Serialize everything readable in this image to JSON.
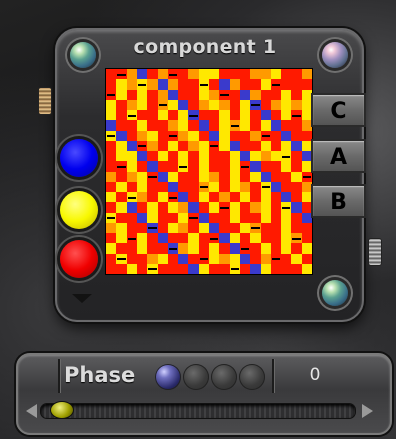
{
  "window": {
    "title": "component 1"
  },
  "side_buttons": [
    "C",
    "A",
    "B"
  ],
  "color_swatches": [
    {
      "name": "blue",
      "color": "#0000ee"
    },
    {
      "name": "yellow",
      "color": "#f8f800"
    },
    {
      "name": "red",
      "color": "#f00000"
    }
  ],
  "matrix": {
    "rows": 20,
    "cols": 20,
    "palette": {
      "R": "#ff1a00",
      "O": "#ff9a00",
      "Y": "#ffe800",
      "B": "#3a3acc"
    },
    "grid": [
      "RROBRORROYYRRROOYRRO",
      "RYOYOBORRYRBORRYRRRR",
      "RYRYROBRRYORRBORRYRY",
      "YROYROYBROYORYBROYOY",
      "YRYRRYRYBRRYRYRBRYRY",
      "BRRYRROYRBRYOYRYBRRO",
      "YBROYRROYRBYRRORRBRR",
      "RYBRORYROYRYBRRYRYBY",
      "RYYBRYRYRYRRYBYOYYRB",
      "RRYRBRRYRYRRYRBRRYRY",
      "OROYRBYRRYORYRYBRRYR",
      "RYRYRRBRROYRYORYBRRO",
      "YRYORYRBRYRORYRYRBRY",
      "RYBRYRYOBRYRYROYRYBR",
      "YRRBYRRYRBRRYRRYRYRB",
      "OYRRBRYORYBRRYORRYRR",
      "RYRYRBRRYRRBYRYRRYOR",
      "YRRYRRBOYRYRBRRYRYRY",
      "RYRROYRBRRYOYBRORRYR",
      "RRYRYRRRBYRRYRBYRRRY"
    ],
    "dashes": [
      "0,1",
      "0,6",
      "1,3",
      "1,9",
      "1,16",
      "2,0",
      "2,11",
      "3,5",
      "3,14",
      "4,2",
      "4,8",
      "4,18",
      "5,12",
      "6,0",
      "6,6",
      "6,15",
      "7,3",
      "7,10",
      "8,17",
      "9,1",
      "9,7",
      "9,13",
      "10,4",
      "10,19",
      "11,9",
      "11,15",
      "12,2",
      "12,6",
      "13,11",
      "13,17",
      "14,0",
      "14,8",
      "15,4",
      "15,14",
      "16,2",
      "16,10",
      "16,18",
      "17,6",
      "17,13",
      "18,1",
      "18,9",
      "18,16",
      "19,4",
      "19,12"
    ]
  },
  "phase": {
    "label": "Phase",
    "value": "0",
    "knobs": [
      true,
      false,
      false,
      false
    ],
    "slider_position": 0.02
  }
}
